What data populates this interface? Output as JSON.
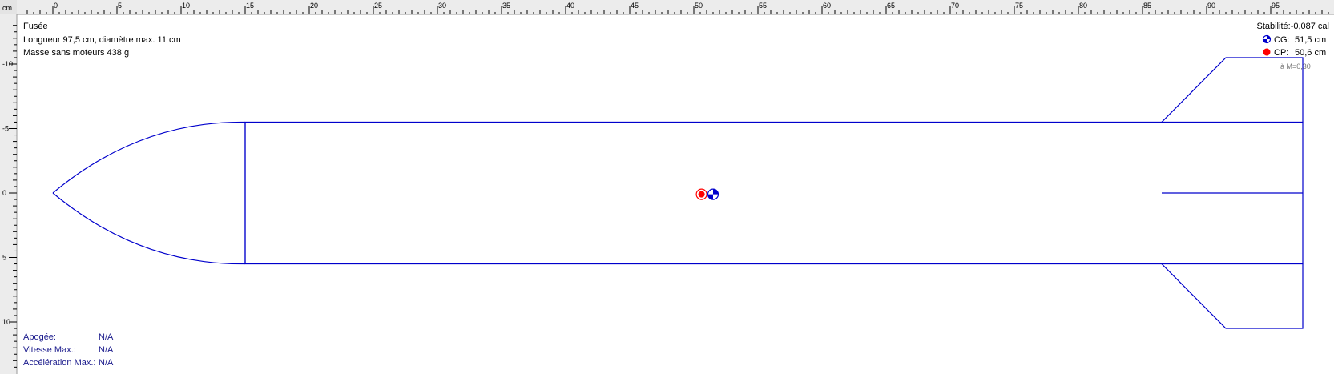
{
  "ruler": {
    "unit": "cm",
    "horizontal_labels": [
      "0",
      "5",
      "10",
      "15",
      "20",
      "25",
      "30",
      "35",
      "40",
      "45",
      "50",
      "55",
      "60",
      "65",
      "70",
      "75",
      "80",
      "85",
      "90",
      "95"
    ],
    "vertical_labels": [
      "-10",
      "-5",
      "0",
      "5",
      "10"
    ]
  },
  "rocket": {
    "name": "Fusée",
    "dimensions": "Longueur 97,5 cm, diamètre max. 11 cm",
    "mass": "Masse sans moteurs 438 g",
    "length_cm": 97.5,
    "diameter_cm": 11,
    "nose_length_cm": 15,
    "fin_root_start_cm": 86.5,
    "fin_tip_start_cm": 91.5,
    "fin_tip_end_cm": 97.5,
    "fin_span_cm": 5
  },
  "stability": {
    "label": "Stabilité:",
    "value": "-0,087 cal",
    "cg_label": "CG:",
    "cg_value": "51,5 cm",
    "cg_cm": 51.5,
    "cp_label": "CP:",
    "cp_value": "50,6 cm",
    "cp_cm": 50.6,
    "mach_note": "à M=0,30"
  },
  "flight": {
    "apogee_label": "Apogée:",
    "apogee_value": "N/A",
    "vmax_label": "Vitesse Max.:",
    "vmax_value": "N/A",
    "amax_label": "Accélération Max.:",
    "amax_value": "N/A"
  },
  "colors": {
    "outline": "#0000cc",
    "cp": "#ff0000",
    "cg": "#0000cc",
    "flight_text": "#1a1a8c"
  }
}
